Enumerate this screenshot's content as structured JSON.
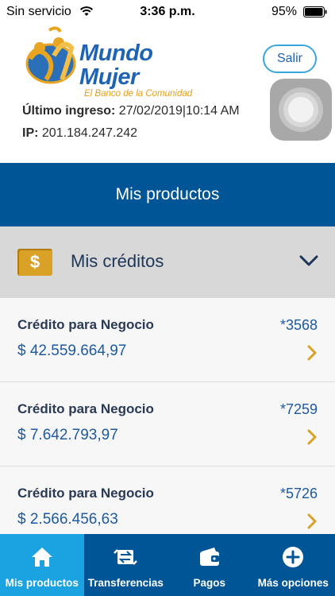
{
  "status_bar": {
    "carrier": "Sin servicio",
    "time": "3:36 p.m.",
    "battery_percent": "95%"
  },
  "header": {
    "brand_name": "Mundo Mujer",
    "brand_tagline": "El Banco de la Comunidad",
    "exit_label": "Salir",
    "last_login_label": "Último ingreso:",
    "last_login_value": " 27/02/2019|10:14 AM",
    "ip_label": "IP:",
    "ip_value": " 201.184.247.242"
  },
  "main": {
    "section_title": "Mis productos",
    "accordion": {
      "title": "Mis créditos",
      "icon": "dollar-icon",
      "expanded": true
    },
    "credits": [
      {
        "name": "Crédito para Negocio",
        "number": "*3568",
        "amount": "$ 42.559.664,97"
      },
      {
        "name": "Crédito para Negocio",
        "number": "*7259",
        "amount": "$ 7.642.793,97"
      },
      {
        "name": "Crédito para Negocio",
        "number": "*5726",
        "amount": "$ 2.566.456,63"
      }
    ]
  },
  "tab_bar": {
    "tabs": [
      {
        "label": "Mis productos",
        "icon": "home-icon",
        "active": true
      },
      {
        "label": "Transferencias",
        "icon": "transfer-icon",
        "active": false
      },
      {
        "label": "Pagos",
        "icon": "wallet-icon",
        "active": false
      },
      {
        "label": "Más opciones",
        "icon": "plus-circle-icon",
        "active": false
      }
    ]
  },
  "colors": {
    "primary_blue": "#005596",
    "active_tab": "#1aa3e0",
    "accent_gold": "#d9a227",
    "accordion_bg": "#d8d8d8"
  }
}
